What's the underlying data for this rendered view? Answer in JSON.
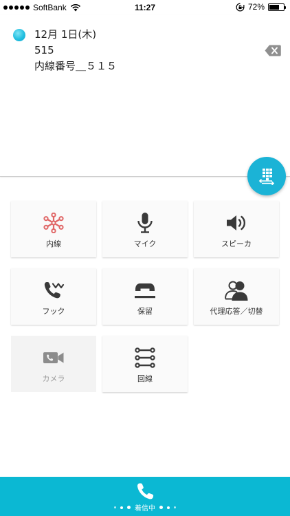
{
  "status_bar": {
    "carrier": "SoftBank",
    "time": "11:27",
    "battery": "72%",
    "battery_level": 0.72
  },
  "call_info": {
    "date": "12月 1日(木)",
    "number": "515",
    "extension_label": "内線番号＿５１５"
  },
  "buttons": {
    "extension": "内線",
    "mic": "マイク",
    "speaker": "スピーカ",
    "hook": "フック",
    "hold": "保留",
    "proxy": "代理応答／切替",
    "camera": "カメラ",
    "line": "回線"
  },
  "bottom_bar": {
    "incoming_label": "着信中"
  },
  "colors": {
    "accent": "#1bb3d6",
    "bottom_bar": "#0bb8d3",
    "extension_icon": "#e06666",
    "icon_dark": "#3a3a3a",
    "icon_disabled": "#8c8c8c"
  }
}
